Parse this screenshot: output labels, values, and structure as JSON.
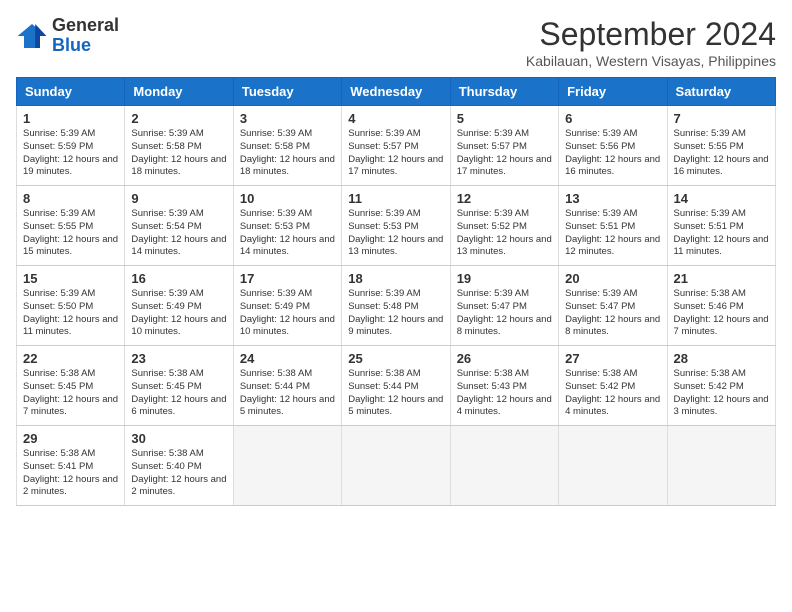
{
  "header": {
    "logo_general": "General",
    "logo_blue": "Blue",
    "month": "September 2024",
    "location": "Kabilauan, Western Visayas, Philippines"
  },
  "weekdays": [
    "Sunday",
    "Monday",
    "Tuesday",
    "Wednesday",
    "Thursday",
    "Friday",
    "Saturday"
  ],
  "weeks": [
    [
      {
        "day": 1,
        "sunrise": "5:39 AM",
        "sunset": "5:59 PM",
        "daylight": "12 hours and 19 minutes."
      },
      {
        "day": 2,
        "sunrise": "5:39 AM",
        "sunset": "5:58 PM",
        "daylight": "12 hours and 18 minutes."
      },
      {
        "day": 3,
        "sunrise": "5:39 AM",
        "sunset": "5:58 PM",
        "daylight": "12 hours and 18 minutes."
      },
      {
        "day": 4,
        "sunrise": "5:39 AM",
        "sunset": "5:57 PM",
        "daylight": "12 hours and 17 minutes."
      },
      {
        "day": 5,
        "sunrise": "5:39 AM",
        "sunset": "5:57 PM",
        "daylight": "12 hours and 17 minutes."
      },
      {
        "day": 6,
        "sunrise": "5:39 AM",
        "sunset": "5:56 PM",
        "daylight": "12 hours and 16 minutes."
      },
      {
        "day": 7,
        "sunrise": "5:39 AM",
        "sunset": "5:55 PM",
        "daylight": "12 hours and 16 minutes."
      }
    ],
    [
      {
        "day": 8,
        "sunrise": "5:39 AM",
        "sunset": "5:55 PM",
        "daylight": "12 hours and 15 minutes."
      },
      {
        "day": 9,
        "sunrise": "5:39 AM",
        "sunset": "5:54 PM",
        "daylight": "12 hours and 14 minutes."
      },
      {
        "day": 10,
        "sunrise": "5:39 AM",
        "sunset": "5:53 PM",
        "daylight": "12 hours and 14 minutes."
      },
      {
        "day": 11,
        "sunrise": "5:39 AM",
        "sunset": "5:53 PM",
        "daylight": "12 hours and 13 minutes."
      },
      {
        "day": 12,
        "sunrise": "5:39 AM",
        "sunset": "5:52 PM",
        "daylight": "12 hours and 13 minutes."
      },
      {
        "day": 13,
        "sunrise": "5:39 AM",
        "sunset": "5:51 PM",
        "daylight": "12 hours and 12 minutes."
      },
      {
        "day": 14,
        "sunrise": "5:39 AM",
        "sunset": "5:51 PM",
        "daylight": "12 hours and 11 minutes."
      }
    ],
    [
      {
        "day": 15,
        "sunrise": "5:39 AM",
        "sunset": "5:50 PM",
        "daylight": "12 hours and 11 minutes."
      },
      {
        "day": 16,
        "sunrise": "5:39 AM",
        "sunset": "5:49 PM",
        "daylight": "12 hours and 10 minutes."
      },
      {
        "day": 17,
        "sunrise": "5:39 AM",
        "sunset": "5:49 PM",
        "daylight": "12 hours and 10 minutes."
      },
      {
        "day": 18,
        "sunrise": "5:39 AM",
        "sunset": "5:48 PM",
        "daylight": "12 hours and 9 minutes."
      },
      {
        "day": 19,
        "sunrise": "5:39 AM",
        "sunset": "5:47 PM",
        "daylight": "12 hours and 8 minutes."
      },
      {
        "day": 20,
        "sunrise": "5:39 AM",
        "sunset": "5:47 PM",
        "daylight": "12 hours and 8 minutes."
      },
      {
        "day": 21,
        "sunrise": "5:38 AM",
        "sunset": "5:46 PM",
        "daylight": "12 hours and 7 minutes."
      }
    ],
    [
      {
        "day": 22,
        "sunrise": "5:38 AM",
        "sunset": "5:45 PM",
        "daylight": "12 hours and 7 minutes."
      },
      {
        "day": 23,
        "sunrise": "5:38 AM",
        "sunset": "5:45 PM",
        "daylight": "12 hours and 6 minutes."
      },
      {
        "day": 24,
        "sunrise": "5:38 AM",
        "sunset": "5:44 PM",
        "daylight": "12 hours and 5 minutes."
      },
      {
        "day": 25,
        "sunrise": "5:38 AM",
        "sunset": "5:44 PM",
        "daylight": "12 hours and 5 minutes."
      },
      {
        "day": 26,
        "sunrise": "5:38 AM",
        "sunset": "5:43 PM",
        "daylight": "12 hours and 4 minutes."
      },
      {
        "day": 27,
        "sunrise": "5:38 AM",
        "sunset": "5:42 PM",
        "daylight": "12 hours and 4 minutes."
      },
      {
        "day": 28,
        "sunrise": "5:38 AM",
        "sunset": "5:42 PM",
        "daylight": "12 hours and 3 minutes."
      }
    ],
    [
      {
        "day": 29,
        "sunrise": "5:38 AM",
        "sunset": "5:41 PM",
        "daylight": "12 hours and 2 minutes."
      },
      {
        "day": 30,
        "sunrise": "5:38 AM",
        "sunset": "5:40 PM",
        "daylight": "12 hours and 2 minutes."
      },
      null,
      null,
      null,
      null,
      null
    ]
  ]
}
